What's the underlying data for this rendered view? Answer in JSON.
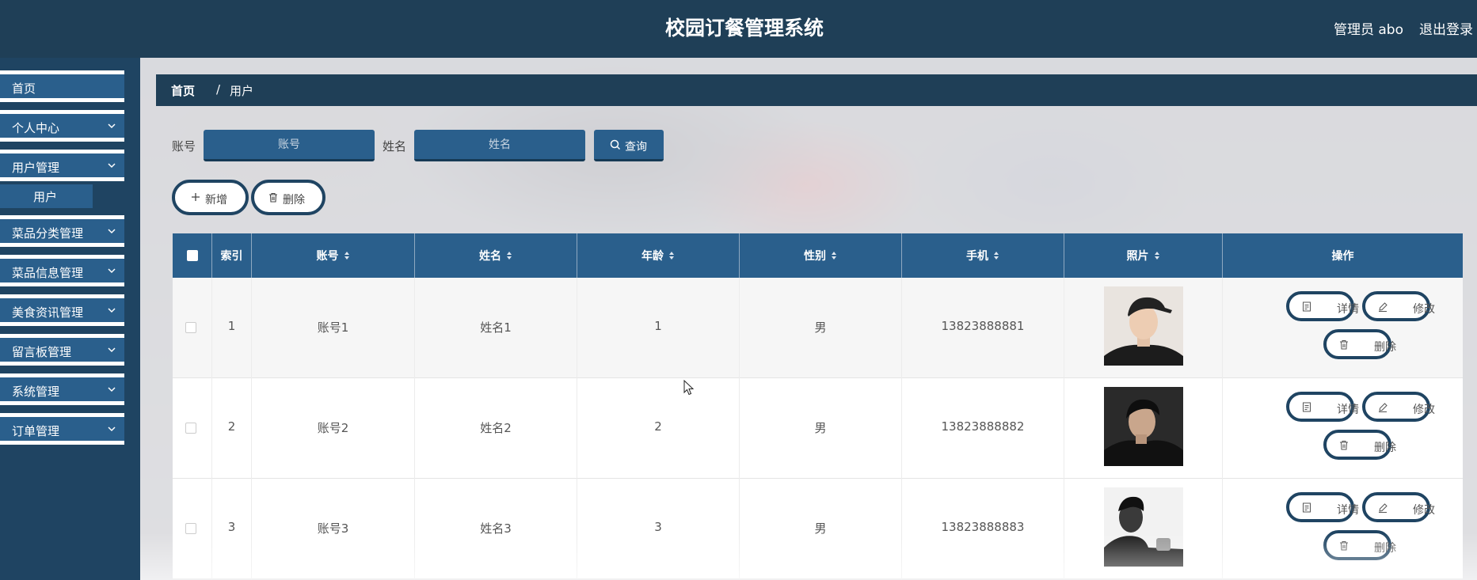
{
  "header": {
    "title": "校园订餐管理系统",
    "user": "管理员 abo",
    "logout": "退出登录"
  },
  "sidebar": {
    "items": [
      {
        "label": "首页",
        "expandable": false
      },
      {
        "label": "个人中心",
        "expandable": true
      },
      {
        "label": "用户管理",
        "expandable": true
      },
      {
        "label": "菜品分类管理",
        "expandable": true
      },
      {
        "label": "菜品信息管理",
        "expandable": true
      },
      {
        "label": "美食资讯管理",
        "expandable": true
      },
      {
        "label": "留言板管理",
        "expandable": true
      },
      {
        "label": "系统管理",
        "expandable": true
      },
      {
        "label": "订单管理",
        "expandable": true
      }
    ],
    "sub_item": "用户"
  },
  "breadcrumb": {
    "home": "首页",
    "separator": "/",
    "current": "用户"
  },
  "search": {
    "account_label": "账号",
    "account_placeholder": "账号",
    "name_label": "姓名",
    "name_placeholder": "姓名",
    "button": "查询"
  },
  "actions": {
    "add": "新增",
    "delete": "删除"
  },
  "table": {
    "headers": [
      "索引",
      "账号",
      "姓名",
      "年龄",
      "性别",
      "手机",
      "照片",
      "操作"
    ],
    "rows": [
      {
        "index": "1",
        "account": "账号1",
        "name": "姓名1",
        "age": "1",
        "gender": "男",
        "phone": "13823888881"
      },
      {
        "index": "2",
        "account": "账号2",
        "name": "姓名2",
        "age": "2",
        "gender": "男",
        "phone": "13823888882"
      },
      {
        "index": "3",
        "account": "账号3",
        "name": "姓名3",
        "age": "3",
        "gender": "男",
        "phone": "13823888883"
      }
    ],
    "row_actions": {
      "detail": "详情",
      "edit": "修改",
      "delete": "删除"
    }
  },
  "colors": {
    "header_bg": "#1f3f57",
    "accent": "#2a5f8c",
    "sidebar_bg": "#1f4462"
  }
}
